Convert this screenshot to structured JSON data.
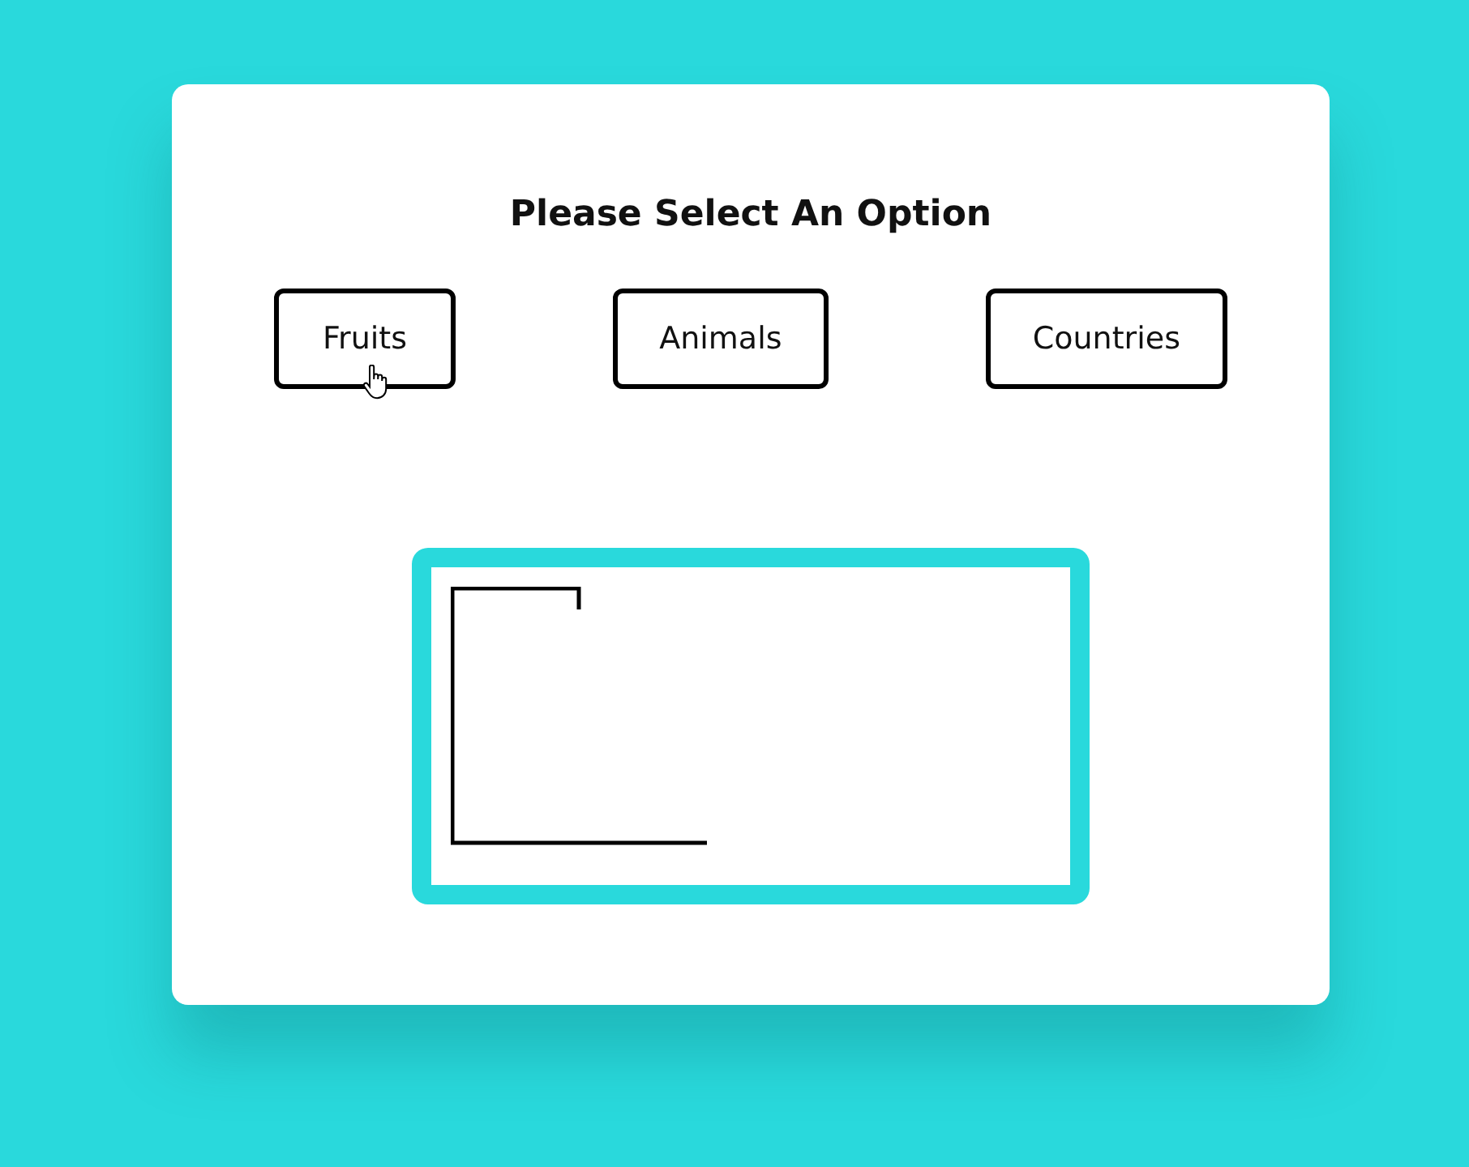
{
  "title": "Please Select An Option",
  "options": [
    {
      "label": "Fruits",
      "hovered": true
    },
    {
      "label": "Animals",
      "hovered": false
    },
    {
      "label": "Countries",
      "hovered": false
    }
  ]
}
